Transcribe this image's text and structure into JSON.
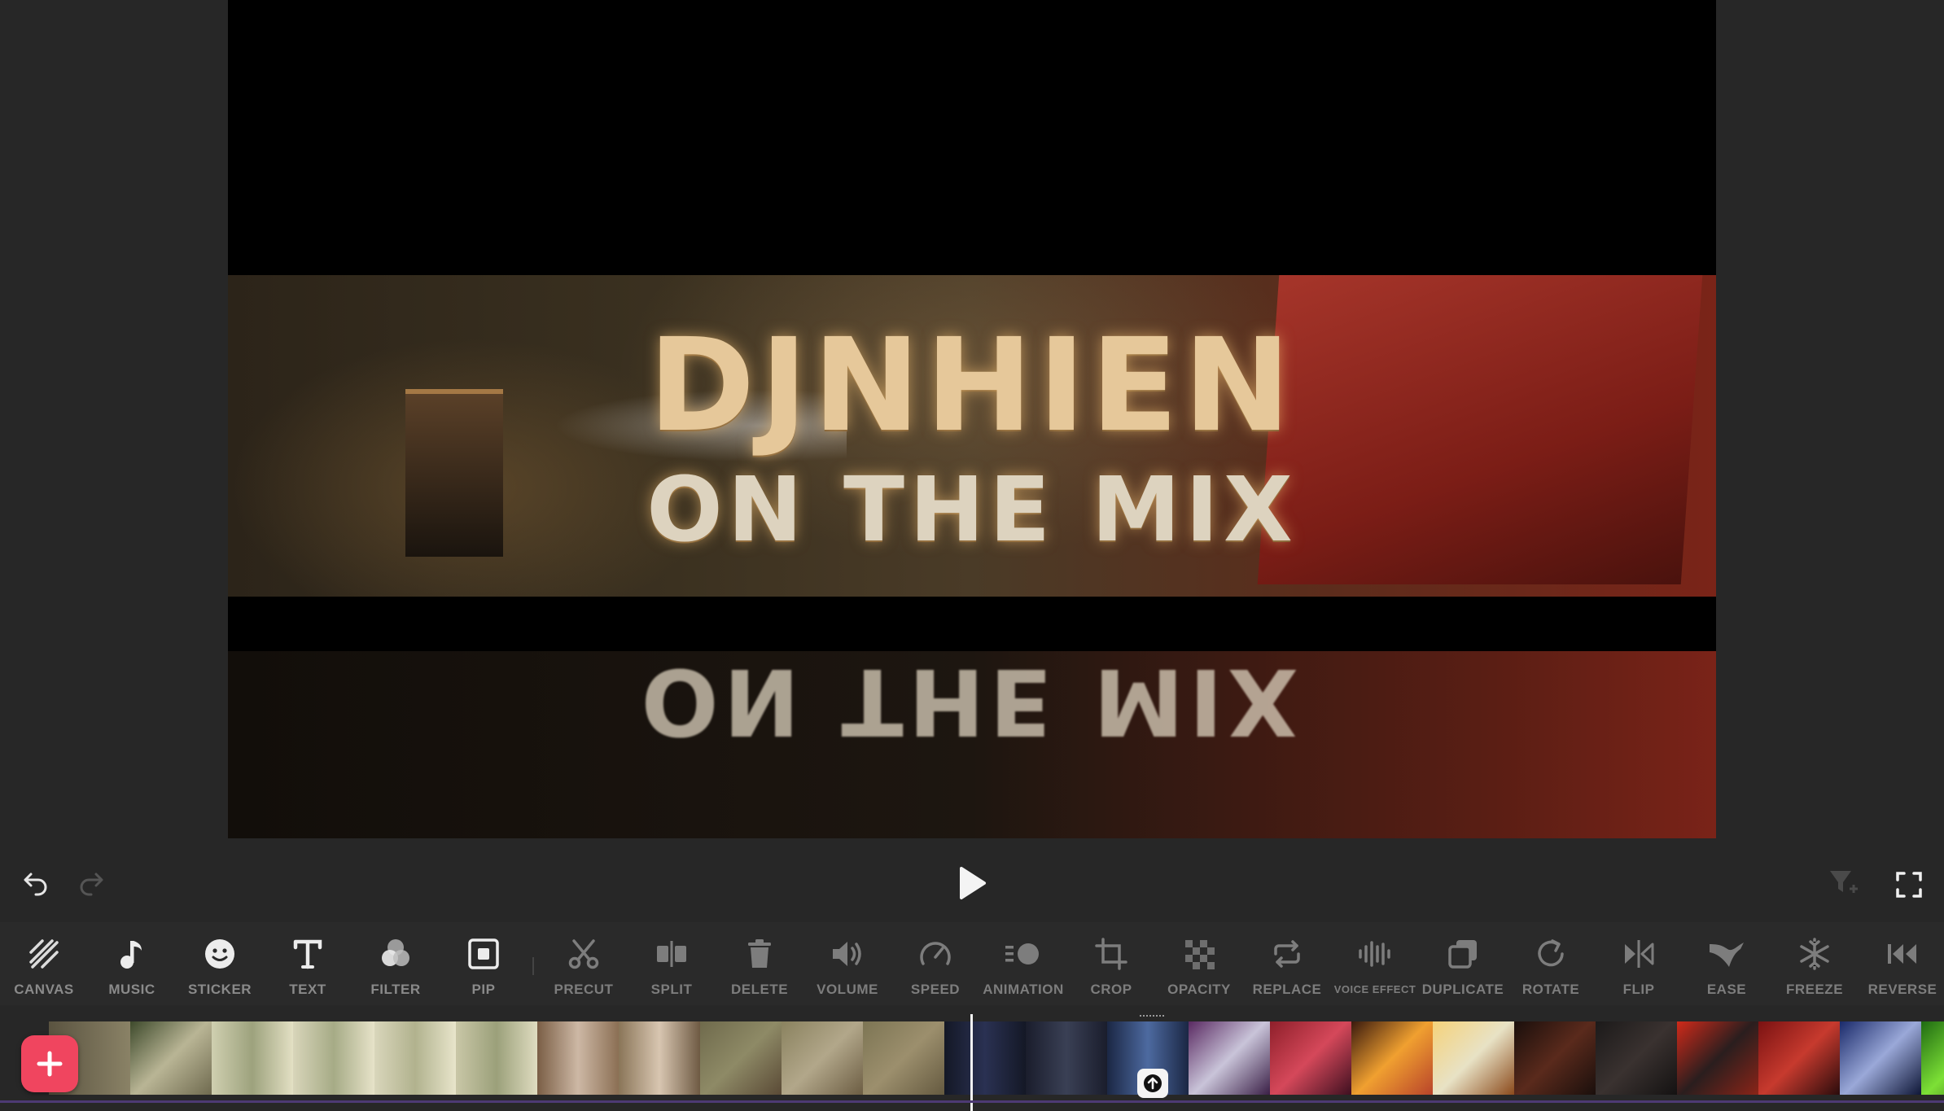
{
  "preview": {
    "title_line1": "DJNHIEN",
    "title_line2": "ON THE MIX",
    "reflection_text": "ON THE MIX"
  },
  "controls": {
    "undo_icon": "undo-arrow",
    "redo_icon": "redo-arrow",
    "play_icon": "play-triangle",
    "export_icon": "funnel-plus",
    "fullscreen_icon": "expand-corners"
  },
  "toolbar": {
    "primary": [
      {
        "label": "CANVAS",
        "icon": "canvas-hatch"
      },
      {
        "label": "MUSIC",
        "icon": "music-note"
      },
      {
        "label": "STICKER",
        "icon": "smiley"
      },
      {
        "label": "TEXT",
        "icon": "text-t"
      },
      {
        "label": "FILTER",
        "icon": "filter-circles"
      },
      {
        "label": "PIP",
        "icon": "picture-in-picture"
      }
    ],
    "edit": [
      {
        "label": "PRECUT",
        "icon": "scissors"
      },
      {
        "label": "SPLIT",
        "icon": "split"
      },
      {
        "label": "DELETE",
        "icon": "trash"
      },
      {
        "label": "VOLUME",
        "icon": "speaker"
      },
      {
        "label": "SPEED",
        "icon": "gauge"
      },
      {
        "label": "ANIMATION",
        "icon": "animation"
      },
      {
        "label": "CROP",
        "icon": "crop"
      },
      {
        "label": "OPACITY",
        "icon": "checker"
      },
      {
        "label": "REPLACE",
        "icon": "replace"
      },
      {
        "label": "VOICE EFFECT",
        "icon": "waveform"
      },
      {
        "label": "DUPLICATE",
        "icon": "duplicate"
      },
      {
        "label": "ROTATE",
        "icon": "rotate"
      },
      {
        "label": "FLIP",
        "icon": "flip"
      },
      {
        "label": "EASE",
        "icon": "ease"
      },
      {
        "label": "FREEZE",
        "icon": "snowflake"
      },
      {
        "label": "REVERSE",
        "icon": "reverse"
      }
    ]
  },
  "timeline": {
    "add_icon": "plus",
    "expand_icon": "arrow-up"
  },
  "colors": {
    "accent": "#f0455f",
    "background": "#272727",
    "label_gray": "#7d7d7d"
  }
}
